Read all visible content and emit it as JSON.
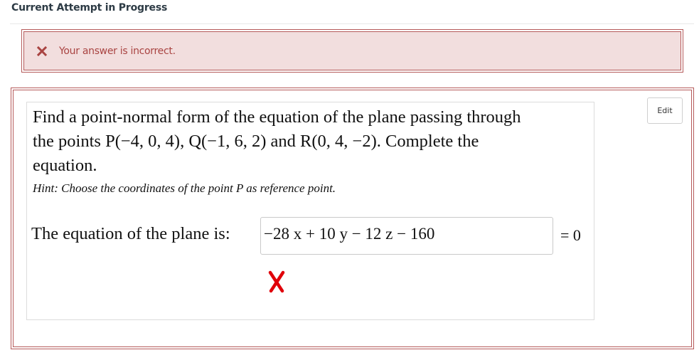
{
  "header": {
    "title": "Current Attempt in Progress"
  },
  "alert": {
    "icon": "close-x-icon",
    "message": "Your answer is incorrect.",
    "color": "#a94442",
    "background": "#f2dede"
  },
  "question": {
    "edit_label": "Edit",
    "prompt_lines": [
      "Find a point-normal form of the equation of the plane passing through",
      "the points P(−4, 0, 4), Q(−1, 6, 2) and R(0, 4, −2). Complete the",
      "equation."
    ],
    "hint": "Hint: Choose the coordinates of the point P as reference point.",
    "equation_label": "The equation of the plane is:",
    "answer_value": "−28 x + 10 y − 12 z − 160",
    "equation_suffix": "= 0",
    "result_icon": "incorrect-x-icon",
    "result_color": "#e0000a"
  }
}
